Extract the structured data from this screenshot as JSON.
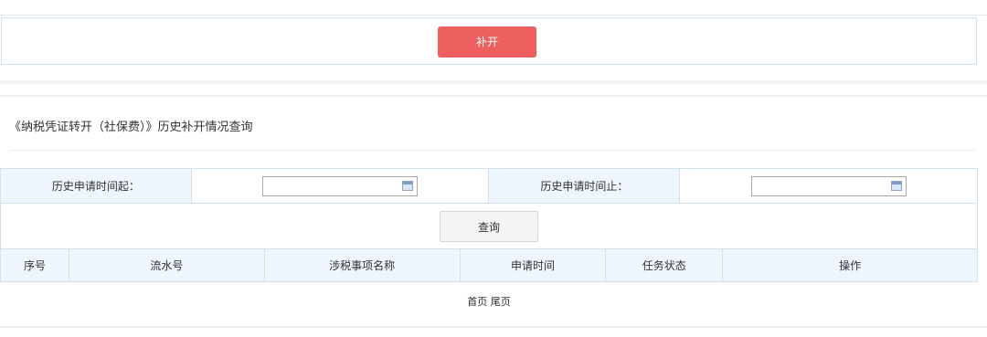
{
  "reissue": {
    "button_label": "补开"
  },
  "section": {
    "title": "《纳税凭证转开（社保费）》历史补开情况查询"
  },
  "search": {
    "start_label": "历史申请时间起：",
    "start_value": "",
    "end_label": "历史申请时间止：",
    "end_value": "",
    "query_label": "查询"
  },
  "results": {
    "columns": [
      "序号",
      "流水号",
      "涉税事项名称",
      "申请时间",
      "任务状态",
      "操作"
    ]
  },
  "pager": {
    "first": "首页",
    "last": "尾页"
  }
}
